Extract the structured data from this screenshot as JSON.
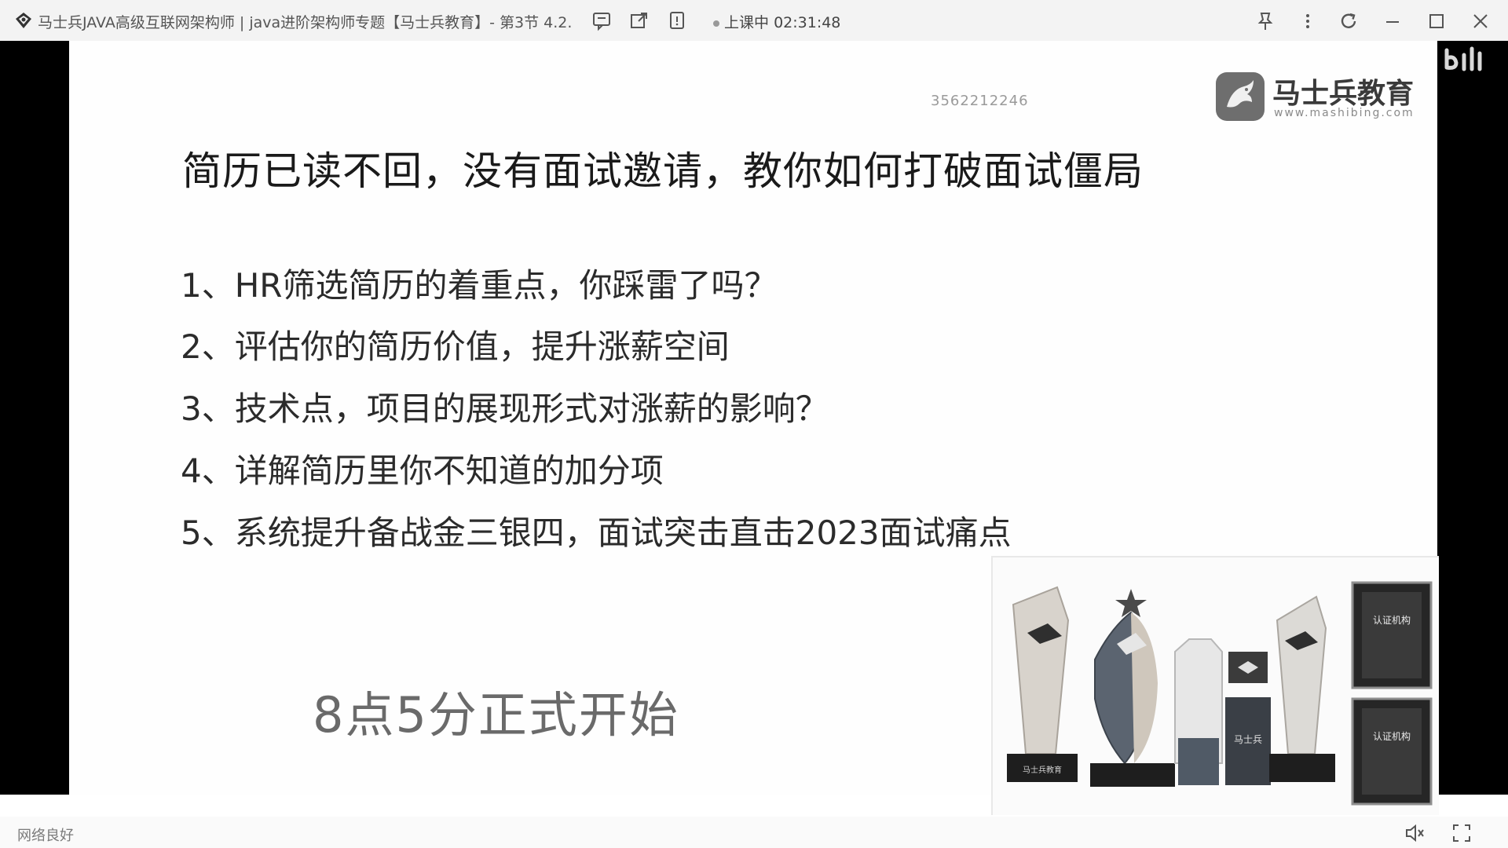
{
  "window": {
    "title": "马士兵JAVA高级互联网架构师 | java进阶架构师专题【马士兵教育】- 第3节 4.2.",
    "status_label": "上课中",
    "status_time": "02:31:48"
  },
  "slide": {
    "stream_id": "3562212246",
    "brand_name": "马士兵教育",
    "brand_url": "www.mashibing.com",
    "heading": "简历已读不回，没有面试邀请，教你如何打破面试僵局",
    "points": [
      "1、HR筛选简历的着重点，你踩雷了吗？",
      "2、评估你的简历价值，提升涨薪空间",
      "3、技术点，项目的展现形式对涨薪的影响？",
      "4、详解简历里你不知道的加分项",
      "5、系统提升备战金三银四，面试突击直击2023面试痛点"
    ],
    "start_time": "8点5分正式开始",
    "award_plaque_text": "认证机构",
    "award_label": "马士兵教育",
    "award_short": "马士兵"
  },
  "statusbar": {
    "network": "网络良好"
  },
  "icons": {
    "app": "app-logo-icon",
    "danmaku": "danmaku-icon",
    "popout": "popout-icon",
    "notes": "notes-icon",
    "pin": "pin-icon",
    "more": "more-icon",
    "refresh": "refresh-icon",
    "minimize": "minimize-icon",
    "maximize": "maximize-icon",
    "close": "close-icon",
    "volume": "volume-icon",
    "fullscreen": "fullscreen-icon"
  },
  "colors": {
    "titlebar_bg": "#f3f3f3",
    "player_bg": "#000000",
    "slide_bg": "#fefefe",
    "start_text": "#6a6a6a"
  }
}
